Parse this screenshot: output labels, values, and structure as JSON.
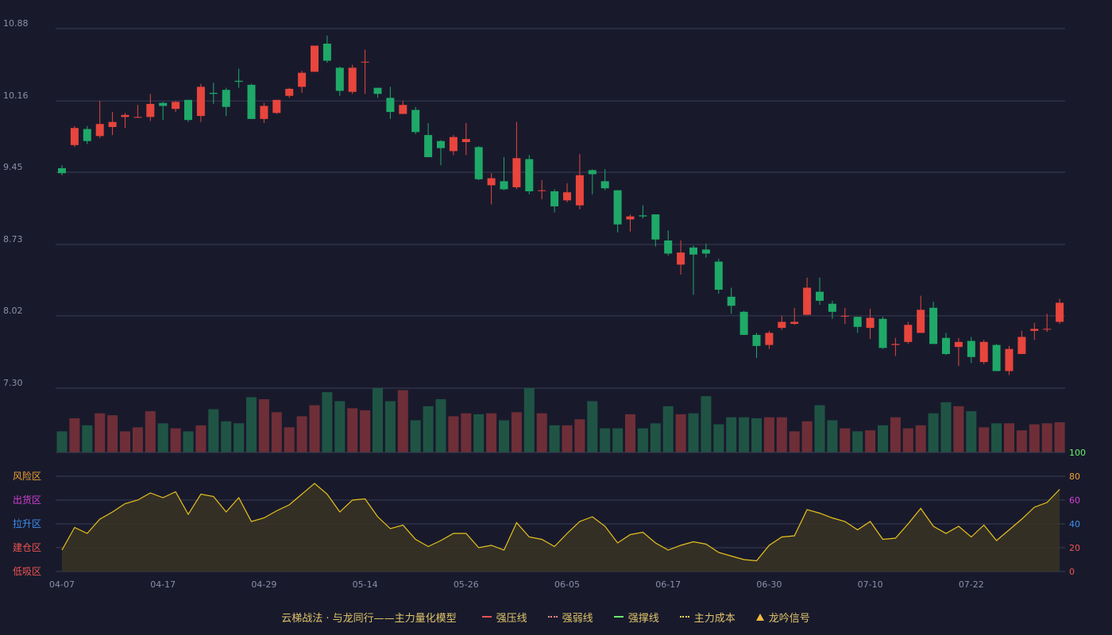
{
  "legend": {
    "title": "云梯战法 · 与龙同行——主力量化模型",
    "items": [
      {
        "label": "强压线",
        "color": "#ef5350",
        "style": "solid"
      },
      {
        "label": "强弱线",
        "color": "#ff8a80",
        "style": "dash"
      },
      {
        "label": "强撑线",
        "color": "#69f06b",
        "style": "solid"
      },
      {
        "label": "主力成本",
        "color": "#ffd54f",
        "style": "dash"
      },
      {
        "label": "龙吟信号",
        "color": "#f5b942",
        "style": "triangle"
      }
    ]
  },
  "colors": {
    "background": "#181a2c",
    "up": "#e8453c",
    "down": "#1fa968",
    "grid": "#3a3d55",
    "axis_text": "#8b8fa8",
    "line": "#e7c21e"
  },
  "chart_data": [
    {
      "type": "candlestick",
      "name": "price",
      "y_ticks": [
        "7.30",
        "8.02",
        "8.73",
        "9.45",
        "10.16",
        "10.88"
      ],
      "ylim": [
        7.3,
        10.88
      ],
      "x_tick_labels": [
        {
          "index": 0,
          "label": "04-07"
        },
        {
          "index": 8,
          "label": "04-17"
        },
        {
          "index": 16,
          "label": "04-29"
        },
        {
          "index": 24,
          "label": "05-14"
        },
        {
          "index": 32,
          "label": "05-26"
        },
        {
          "index": 40,
          "label": "06-05"
        },
        {
          "index": 48,
          "label": "06-17"
        },
        {
          "index": 56,
          "label": "06-30"
        },
        {
          "index": 64,
          "label": "07-10"
        },
        {
          "index": 72,
          "label": "07-22"
        }
      ],
      "candles": [
        [
          9.49,
          9.44,
          9.52,
          9.42
        ],
        [
          9.72,
          9.89,
          9.91,
          9.7
        ],
        [
          9.88,
          9.76,
          9.91,
          9.73
        ],
        [
          9.81,
          9.93,
          10.16,
          9.79
        ],
        [
          9.9,
          9.95,
          10.05,
          9.82
        ],
        [
          10.0,
          10.02,
          10.04,
          9.89
        ],
        [
          10.0,
          10.0,
          10.12,
          9.99
        ],
        [
          10.0,
          10.13,
          10.23,
          9.96
        ],
        [
          10.14,
          10.11,
          10.15,
          9.97
        ],
        [
          10.08,
          10.15,
          10.16,
          10.05
        ],
        [
          10.17,
          9.97,
          10.17,
          9.95
        ],
        [
          10.01,
          10.3,
          10.33,
          9.95
        ],
        [
          10.24,
          10.23,
          10.34,
          10.13
        ],
        [
          10.27,
          10.1,
          10.29,
          10.01
        ],
        [
          10.36,
          10.35,
          10.48,
          10.29
        ],
        [
          10.32,
          9.98,
          10.33,
          9.98
        ],
        [
          9.98,
          10.11,
          10.14,
          9.94
        ],
        [
          10.04,
          10.17,
          10.17,
          10.03
        ],
        [
          10.21,
          10.28,
          10.29,
          10.19
        ],
        [
          10.3,
          10.44,
          10.46,
          10.24
        ],
        [
          10.45,
          10.71,
          10.71,
          10.45
        ],
        [
          10.73,
          10.56,
          10.81,
          10.54
        ],
        [
          10.49,
          10.26,
          10.5,
          10.21
        ],
        [
          10.25,
          10.49,
          10.52,
          10.23
        ],
        [
          10.55,
          10.55,
          10.67,
          10.23
        ],
        [
          10.29,
          10.23,
          10.29,
          10.19
        ],
        [
          10.19,
          10.05,
          10.3,
          9.98
        ],
        [
          10.03,
          10.12,
          10.16,
          10.03
        ],
        [
          10.07,
          9.85,
          10.1,
          9.83
        ],
        [
          9.82,
          9.6,
          9.94,
          9.6
        ],
        [
          9.76,
          9.69,
          9.77,
          9.52
        ],
        [
          9.66,
          9.8,
          9.82,
          9.62
        ],
        [
          9.75,
          9.78,
          9.94,
          9.62
        ],
        [
          9.7,
          9.38,
          9.71,
          9.37
        ],
        [
          9.32,
          9.39,
          9.44,
          9.13
        ],
        [
          9.36,
          9.28,
          9.6,
          9.27
        ],
        [
          9.3,
          9.59,
          9.95,
          9.28
        ],
        [
          9.58,
          9.26,
          9.62,
          9.23
        ],
        [
          9.27,
          9.27,
          9.37,
          9.18
        ],
        [
          9.26,
          9.11,
          9.28,
          9.05
        ],
        [
          9.17,
          9.25,
          9.34,
          9.15
        ],
        [
          9.12,
          9.42,
          9.63,
          9.08
        ],
        [
          9.47,
          9.43,
          9.48,
          9.23
        ],
        [
          9.36,
          9.29,
          9.48,
          9.27
        ],
        [
          9.27,
          8.93,
          9.27,
          8.85
        ],
        [
          8.98,
          9.01,
          9.03,
          8.86
        ],
        [
          9.02,
          9.01,
          9.12,
          8.99
        ],
        [
          9.03,
          8.78,
          9.03,
          8.71
        ],
        [
          8.77,
          8.64,
          8.87,
          8.62
        ],
        [
          8.53,
          8.65,
          8.77,
          8.43
        ],
        [
          8.7,
          8.63,
          8.72,
          8.23
        ],
        [
          8.68,
          8.64,
          8.74,
          8.6
        ],
        [
          8.56,
          8.28,
          8.59,
          8.24
        ],
        [
          8.21,
          8.12,
          8.3,
          8.04
        ],
        [
          8.06,
          7.83,
          8.07,
          7.83
        ],
        [
          7.83,
          7.72,
          7.85,
          7.6
        ],
        [
          7.73,
          7.85,
          7.87,
          7.69
        ],
        [
          7.9,
          7.96,
          8.02,
          7.88
        ],
        [
          7.94,
          7.96,
          8.1,
          7.93
        ],
        [
          8.03,
          8.3,
          8.4,
          8.03
        ],
        [
          8.26,
          8.17,
          8.4,
          8.13
        ],
        [
          8.14,
          8.06,
          8.17,
          7.99
        ],
        [
          8.02,
          8.02,
          8.1,
          7.94
        ],
        [
          8.01,
          7.91,
          8.01,
          7.85
        ],
        [
          7.9,
          8.0,
          8.09,
          7.79
        ],
        [
          7.99,
          7.7,
          8.01,
          7.69
        ],
        [
          7.73,
          7.74,
          7.8,
          7.62
        ],
        [
          7.76,
          7.93,
          7.96,
          7.74
        ],
        [
          7.85,
          8.08,
          8.22,
          7.85
        ],
        [
          8.1,
          7.74,
          8.16,
          7.74
        ],
        [
          7.8,
          7.64,
          7.85,
          7.63
        ],
        [
          7.71,
          7.76,
          7.8,
          7.52
        ],
        [
          7.77,
          7.61,
          7.81,
          7.55
        ],
        [
          7.56,
          7.76,
          7.78,
          7.54
        ],
        [
          7.73,
          7.47,
          7.74,
          7.47
        ],
        [
          7.47,
          7.69,
          7.72,
          7.43
        ],
        [
          7.64,
          7.81,
          7.87,
          7.64
        ],
        [
          7.87,
          7.89,
          7.95,
          7.78
        ],
        [
          7.89,
          7.89,
          8.04,
          7.86
        ],
        [
          7.96,
          8.15,
          8.19,
          7.94
        ]
      ]
    },
    {
      "type": "bar",
      "name": "volume",
      "values": [
        21,
        34,
        27,
        39,
        37,
        21,
        25,
        41,
        29,
        24,
        21,
        27,
        43,
        31,
        29,
        55,
        53,
        40,
        25,
        36,
        47,
        60,
        51,
        44,
        42,
        64,
        51,
        62,
        32,
        46,
        53,
        36,
        39,
        38,
        39,
        32,
        40,
        64,
        39,
        27,
        27,
        33,
        51,
        24,
        24,
        38,
        24,
        29,
        46,
        38,
        39,
        56,
        28,
        35,
        35,
        34,
        35,
        35,
        21,
        31,
        47,
        32,
        24,
        21,
        22,
        27,
        35,
        24,
        27,
        39,
        50,
        46,
        41,
        25,
        29,
        29,
        22,
        28,
        29,
        30
      ]
    },
    {
      "type": "line",
      "name": "oscillator",
      "y_ticks": [
        "0",
        "20",
        "40",
        "60",
        "80",
        "100"
      ],
      "ylim": [
        0,
        100
      ],
      "zone_labels": [
        "风险区",
        "出货区",
        "拉升区",
        "建仓区",
        "低吸区"
      ],
      "zone_colors": [
        "#f0a030",
        "#d43fd4",
        "#3f8ff0",
        "#ef5350",
        "#ef5350"
      ],
      "tick_colors": [
        "#ef5350",
        "#ef5350",
        "#3f8ff0",
        "#d43fd4",
        "#f0a030",
        "#69f06b"
      ],
      "values": [
        18,
        37,
        32,
        44,
        50,
        57,
        60,
        66,
        62,
        67,
        48,
        65,
        63,
        50,
        62,
        42,
        45,
        51,
        56,
        65,
        74,
        65,
        50,
        60,
        61,
        46,
        36,
        39,
        27,
        21,
        26,
        32,
        32,
        20,
        22,
        18,
        41,
        29,
        27,
        21,
        32,
        42,
        46,
        38,
        24,
        31,
        33,
        24,
        18,
        22,
        25,
        23,
        16,
        13,
        10,
        9,
        22,
        29,
        30,
        52,
        49,
        45,
        42,
        35,
        42,
        27,
        28,
        40,
        53,
        38,
        32,
        38,
        29,
        39,
        26,
        35,
        44,
        54,
        58,
        69
      ]
    }
  ]
}
